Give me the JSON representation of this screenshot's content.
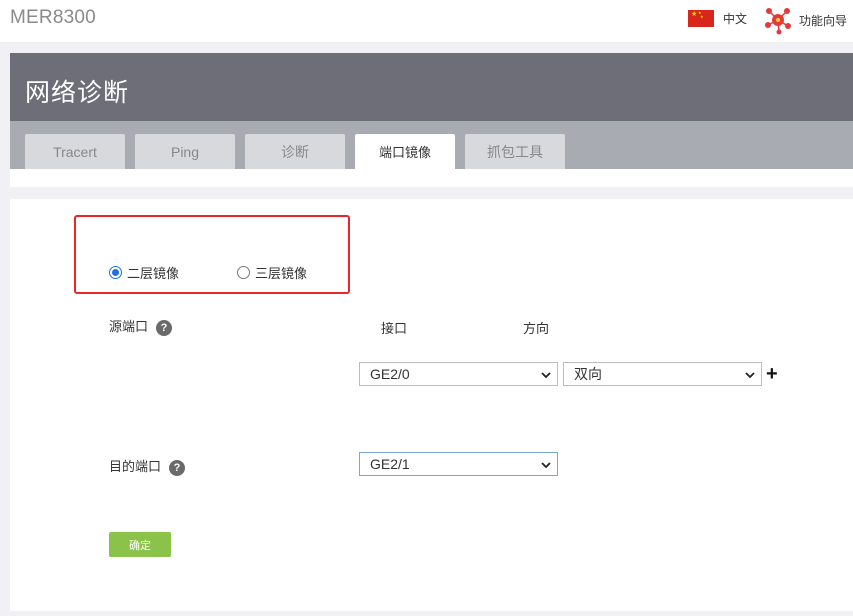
{
  "header": {
    "brand": "MER8300",
    "language": "中文",
    "wizard": "功能向导"
  },
  "page": {
    "title": "网络诊断",
    "tabs": [
      {
        "label": "Tracert",
        "active": false
      },
      {
        "label": "Ping",
        "active": false
      },
      {
        "label": "诊断",
        "active": false
      },
      {
        "label": "端口镜像",
        "active": true
      },
      {
        "label": "抓包工具",
        "active": false
      }
    ]
  },
  "mirror": {
    "options": [
      {
        "label": "二层镜像",
        "checked": true
      },
      {
        "label": "三层镜像",
        "checked": false
      }
    ],
    "source_label": "源端口",
    "col_interface": "接口",
    "col_direction": "方向",
    "source_interface": "GE2/0",
    "source_direction": "双向",
    "dest_label": "目的端口",
    "dest_interface": "GE2/1",
    "confirm": "确定"
  },
  "colors": {
    "accent": "#8bc34a",
    "highlight": "#e8272b",
    "header_bg": "#6d6e78"
  }
}
